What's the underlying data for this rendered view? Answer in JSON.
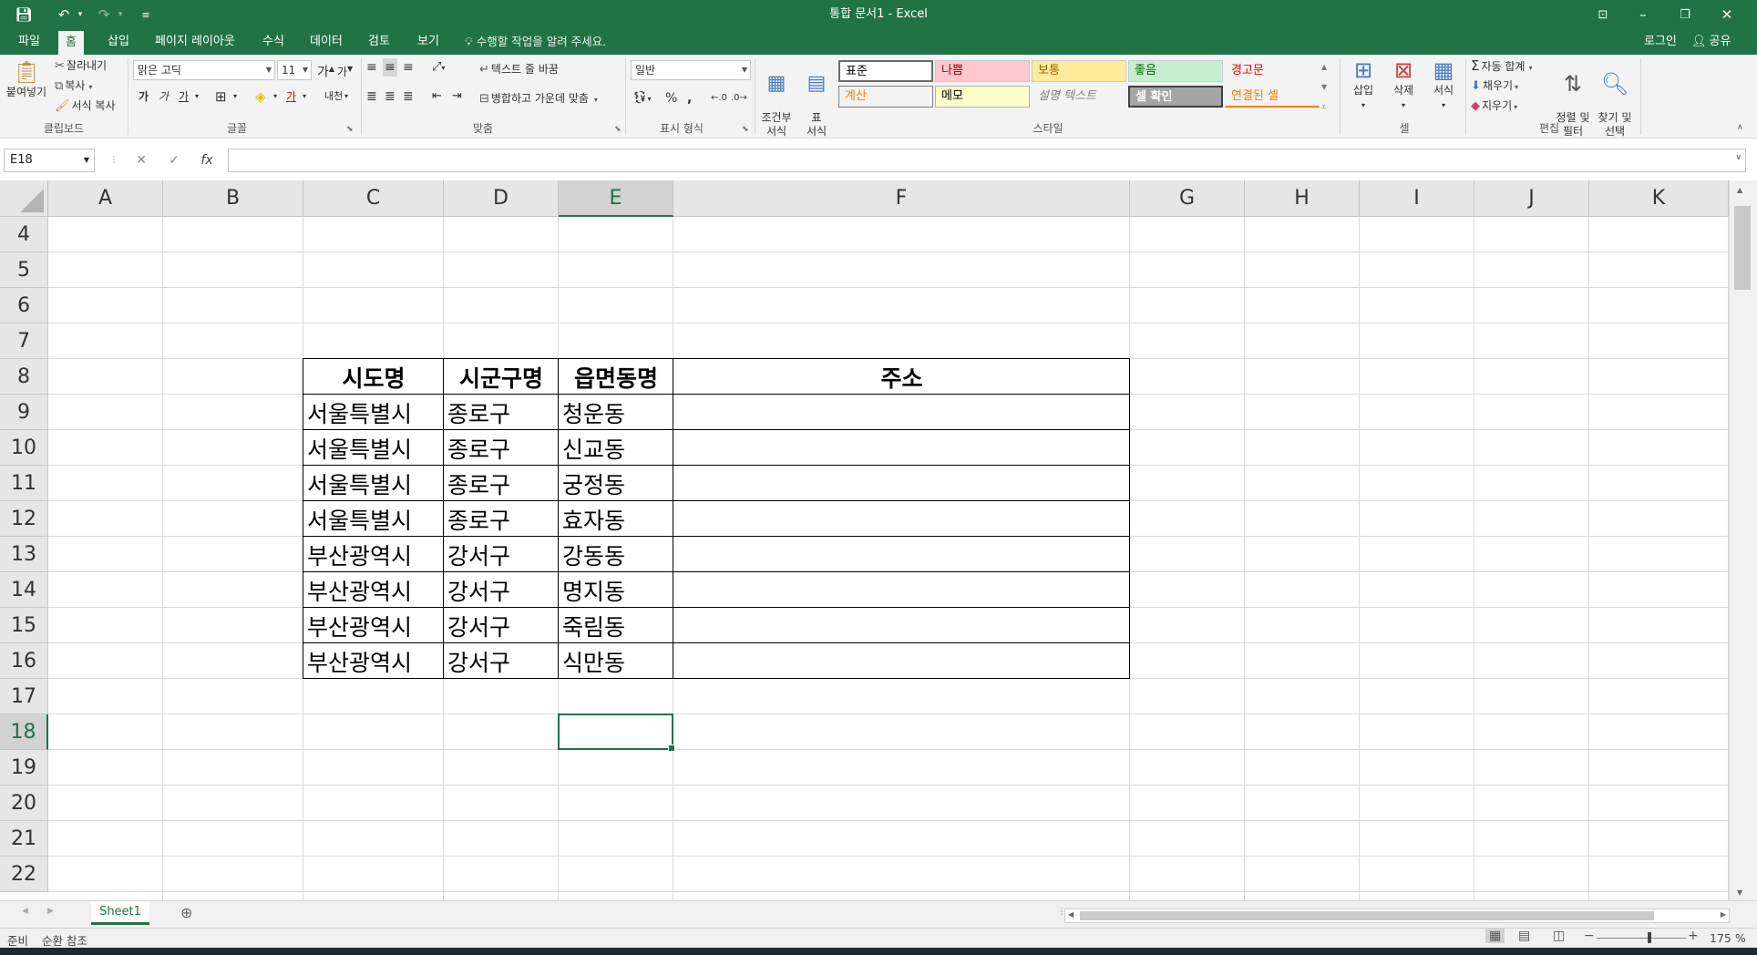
{
  "window": {
    "title": "통합 문서1 - Excel",
    "accent_color": "#217346"
  },
  "quick_access": {
    "save_icon": "save-icon",
    "undo_icon": "undo-icon",
    "redo_icon": "redo-icon",
    "customize_icon": "customize-icon"
  },
  "tabs": [
    "파일",
    "홈",
    "삽입",
    "페이지 레이아웃",
    "수식",
    "데이터",
    "검토",
    "보기"
  ],
  "active_tab": "홈",
  "tell_me": "수행할 작업을 알려 주세요.",
  "login": "로그인",
  "share": "공유",
  "ribbon": {
    "clipboard": {
      "label": "클립보드",
      "paste": "붙여넣기",
      "cut": "잘라내기",
      "copy": "복사",
      "format_painter": "서식 복사"
    },
    "font": {
      "label": "글꼴",
      "font_name": "맑은 고딕",
      "font_size": "11",
      "grow": "가",
      "shrink": "가",
      "bold": "가",
      "italic": "가",
      "underline": "가",
      "font_color": "가",
      "phonetic": "내천"
    },
    "alignment": {
      "label": "맞춤",
      "wrap_text": "텍스트 줄 바꿈",
      "merge_center": "병합하고 가운데 맞춤"
    },
    "number": {
      "label": "표시 형식",
      "format": "일반",
      "percent": "%",
      "comma": ","
    },
    "styles": {
      "label": "스타일",
      "conditional_format": "조건부\n서식",
      "format_as_table": "표\n서식",
      "cells": [
        {
          "name": "표준",
          "bg": "#ffffff",
          "fg": "#000000"
        },
        {
          "name": "나쁨",
          "bg": "#ffc7ce",
          "fg": "#9c0006"
        },
        {
          "name": "보통",
          "bg": "#ffeb9c",
          "fg": "#9c6500"
        },
        {
          "name": "좋음",
          "bg": "#c6efce",
          "fg": "#006100"
        },
        {
          "name": "경고문",
          "bg": "#f3f3f3",
          "fg": "#ff0000"
        },
        {
          "name": "계산",
          "bg": "#f2f2f2",
          "fg": "#fa7d00"
        },
        {
          "name": "메모",
          "bg": "#ffffcc",
          "fg": "#000000"
        },
        {
          "name": "설명 텍스트",
          "bg": "#f3f3f3",
          "fg": "#7f7f7f"
        },
        {
          "name": "셀 확인",
          "bg": "#a5a5a5",
          "fg": "#ffffff"
        },
        {
          "name": "연결된 셀",
          "bg": "#f3f3f3",
          "fg": "#fa7d00"
        }
      ]
    },
    "cells_group": {
      "label": "셀",
      "insert": "삽입",
      "delete": "삭제",
      "format": "서식"
    },
    "editing": {
      "label": "편집",
      "autosum": "자동 합계",
      "fill": "채우기",
      "clear": "지우기",
      "sort_filter": "정렬 및\n필터",
      "find_select": "찾기 및\n선택"
    }
  },
  "formula_bar": {
    "name_box": "E18",
    "cancel": "✕",
    "enter": "✓",
    "fx": "fx",
    "value": ""
  },
  "columns": [
    "A",
    "B",
    "C",
    "D",
    "E",
    "F",
    "G",
    "H",
    "I",
    "J",
    "K"
  ],
  "selected_column": "E",
  "rows": [
    "4",
    "5",
    "6",
    "7",
    "8",
    "9",
    "10",
    "11",
    "12",
    "13",
    "14",
    "15",
    "16",
    "17",
    "18",
    "19",
    "20",
    "21",
    "22"
  ],
  "selected_row": "18",
  "table": {
    "headers": [
      "시도명",
      "시군구명",
      "읍면동명",
      "주소"
    ],
    "rows": [
      [
        "서울특별시",
        "종로구",
        "청운동",
        ""
      ],
      [
        "서울특별시",
        "종로구",
        "신교동",
        ""
      ],
      [
        "서울특별시",
        "종로구",
        "궁정동",
        ""
      ],
      [
        "서울특별시",
        "종로구",
        "효자동",
        ""
      ],
      [
        "부산광역시",
        "강서구",
        "강동동",
        ""
      ],
      [
        "부산광역시",
        "강서구",
        "명지동",
        ""
      ],
      [
        "부산광역시",
        "강서구",
        "죽림동",
        ""
      ],
      [
        "부산광역시",
        "강서구",
        "식만동",
        ""
      ]
    ]
  },
  "sheets": [
    "Sheet1"
  ],
  "status": {
    "ready": "준비",
    "circular": "순환 참조",
    "zoom": "175 %"
  }
}
